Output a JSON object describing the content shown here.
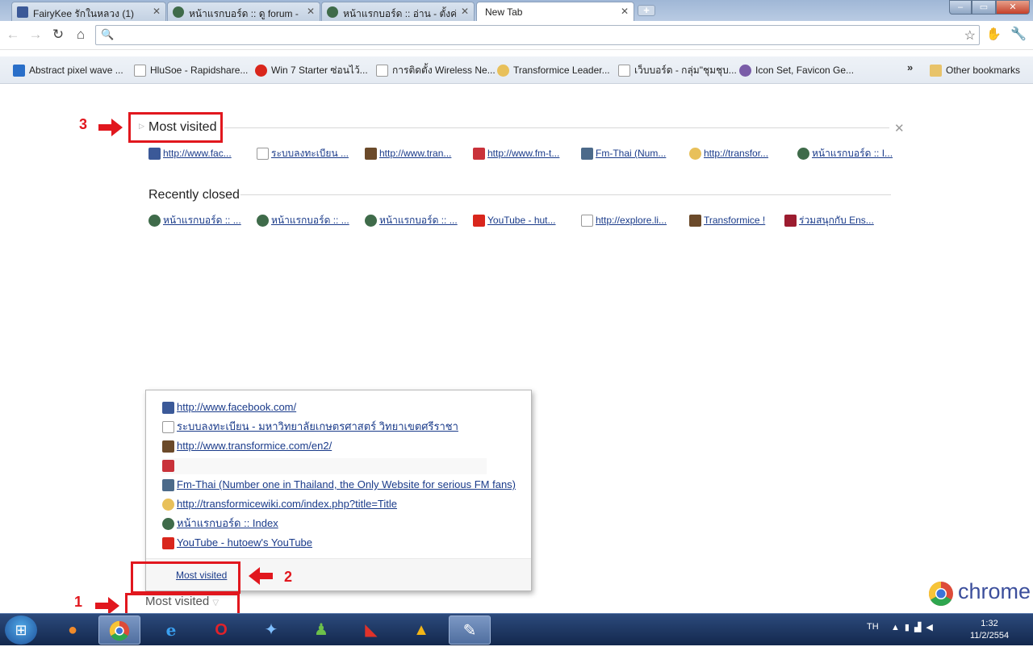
{
  "tabs": [
    {
      "label": "FairyKee รักในหลวง (1)",
      "icon": "facebook-icon",
      "color": "#3b5998"
    },
    {
      "label": "หน้าแรกบอร์ด :: ดู forum - ...",
      "icon": "forum-icon",
      "color": "#3f6b4a"
    },
    {
      "label": "หน้าแรกบอร์ด :: อ่าน - ตั้งค่า...",
      "icon": "forum-icon",
      "color": "#3f6b4a"
    },
    {
      "label": "New Tab"
    }
  ],
  "new_tab_button": "+",
  "window": {
    "minimize": "–",
    "maximize": "▭",
    "close": "✕"
  },
  "omnibox": {
    "value": "",
    "placeholder": ""
  },
  "bookmarks": [
    {
      "label": "Abstract pixel wave ...",
      "icon": "wave-icon",
      "color": "#2a6fc9"
    },
    {
      "label": "HluSoe - Rapidshare...",
      "icon": "page-icon",
      "color": "#ffffff"
    },
    {
      "label": "Win 7 Starter ซ่อนไว้...",
      "icon": "alert-icon",
      "color": "#d9261c"
    },
    {
      "label": "การติดตั้ง Wireless Ne...",
      "icon": "page-icon",
      "color": "#ffffff"
    },
    {
      "label": "Transformice Leader...",
      "icon": "cheese-icon",
      "color": "#e8c05a"
    },
    {
      "label": "เว็บบอร์ด - กลุ่ม\"ชุมชุบ...",
      "icon": "page-icon",
      "color": "#ffffff"
    },
    {
      "label": "Icon Set, Favicon Ge...",
      "icon": "globe-icon",
      "color": "#7a5ca8"
    }
  ],
  "bookmarks_overflow": "»",
  "other_bookmarks": "Other bookmarks",
  "ntp": {
    "most_visited_title": "Most visited",
    "close": "✕",
    "most_visited": [
      {
        "label": "http://www.fac...",
        "icon": "facebook-icon",
        "color": "#3b5998"
      },
      {
        "label": "ระบบลงทะเบียน ...",
        "icon": "page-icon",
        "color": "#ffffff"
      },
      {
        "label": "http://www.tran...",
        "icon": "transformice-icon",
        "color": "#6b4a2a"
      },
      {
        "label": "http://www.fm-t...",
        "icon": "fm-icon",
        "color": "#c9323a"
      },
      {
        "label": "Fm-Thai (Num...",
        "icon": "hat-icon",
        "color": "#4c6a8a"
      },
      {
        "label": "http://transfor...",
        "icon": "cheese-icon",
        "color": "#e8c05a"
      },
      {
        "label": "หน้าแรกบอร์ด :: I...",
        "icon": "forum-icon",
        "color": "#3f6b4a"
      }
    ],
    "recently_closed_title": "Recently closed",
    "recently_closed": [
      {
        "label": "หน้าแรกบอร์ด :: ...",
        "icon": "forum-icon",
        "color": "#3f6b4a"
      },
      {
        "label": "หน้าแรกบอร์ด :: ...",
        "icon": "forum-icon",
        "color": "#3f6b4a"
      },
      {
        "label": "หน้าแรกบอร์ด :: ...",
        "icon": "forum-icon",
        "color": "#3f6b4a"
      },
      {
        "label": "YouTube - hut...",
        "icon": "youtube-icon",
        "color": "#d9261c"
      },
      {
        "label": "http://explore.li...",
        "icon": "page-icon",
        "color": "#ffffff"
      },
      {
        "label": "Transformice !",
        "icon": "transformice-icon",
        "color": "#6b4a2a"
      },
      {
        "label": "ร่วมสนุกกับ Ens...",
        "icon": "e-icon",
        "color": "#9c1c2f"
      }
    ]
  },
  "menu": {
    "items": [
      {
        "label": "http://www.facebook.com/",
        "icon": "facebook-icon",
        "color": "#3b5998"
      },
      {
        "label": "ระบบลงทะเบียน - มหาวิทยาลัยเกษตรศาสตร์ วิทยาเขตศรีราชา",
        "icon": "page-icon",
        "color": "#ffffff"
      },
      {
        "label": "http://www.transformice.com/en2/",
        "icon": "transformice-icon",
        "color": "#6b4a2a"
      },
      {
        "label": "",
        "icon": "fm-icon",
        "color": "#c9323a"
      },
      {
        "label": "Fm-Thai (Number one in Thailand, the Only Website for serious FM fans)",
        "icon": "hat-icon",
        "color": "#4c6a8a"
      },
      {
        "label": "http://transformicewiki.com/index.php?title=Title",
        "icon": "cheese-icon",
        "color": "#e8c05a"
      },
      {
        "label": "หน้าแรกบอร์ด :: Index",
        "icon": "forum-icon",
        "color": "#3f6b4a"
      },
      {
        "label": "YouTube - hutoew's YouTube",
        "icon": "youtube-icon",
        "color": "#d9261c"
      }
    ],
    "footer_link": "Most visited"
  },
  "bottom_selector": "Most visited",
  "annotations": {
    "n1": "1",
    "n2": "2",
    "n3": "3",
    "color": "#e1171e"
  },
  "chrome_logo_text": "chrome",
  "taskbar": {
    "apps": [
      {
        "name": "firefox-icon",
        "glyph": "🦊"
      },
      {
        "name": "chrome-icon",
        "glyph": "◉"
      },
      {
        "name": "ie-icon",
        "glyph": "e"
      },
      {
        "name": "opera-icon",
        "glyph": "O"
      },
      {
        "name": "safari-icon",
        "glyph": "✦"
      },
      {
        "name": "messenger-icon",
        "glyph": "👥"
      },
      {
        "name": "winamp-icon",
        "glyph": "◣"
      },
      {
        "name": "alert-app-icon",
        "glyph": "▲"
      },
      {
        "name": "paint-icon",
        "glyph": "🎨"
      }
    ],
    "lang": "TH",
    "time": "1:32",
    "date": "11/2/2554"
  }
}
